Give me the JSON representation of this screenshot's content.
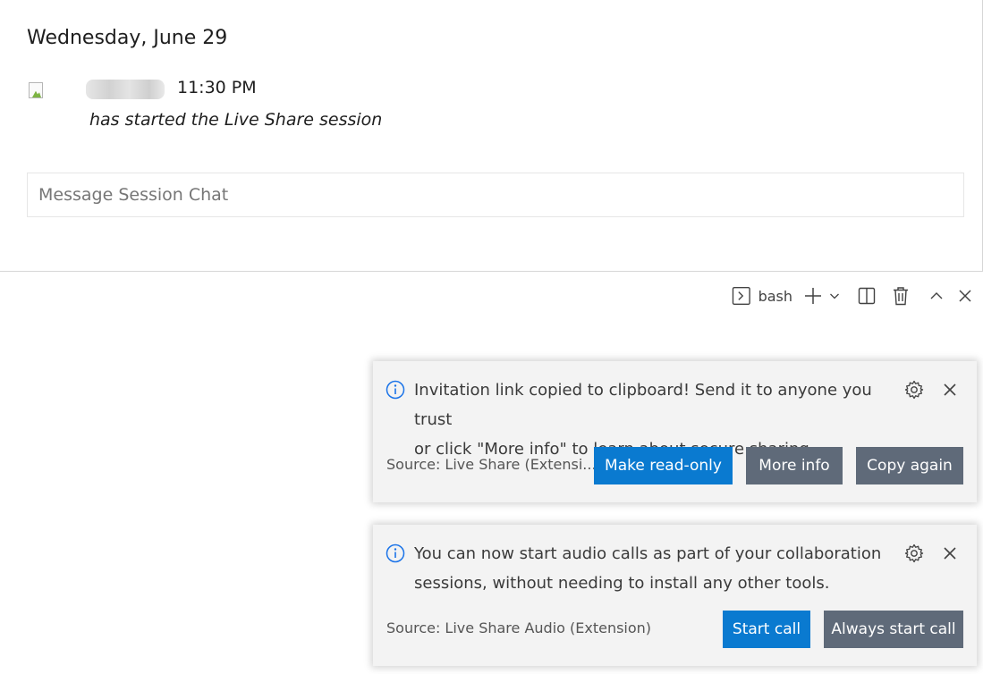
{
  "chat": {
    "date_heading": "Wednesday, June 29",
    "message": {
      "time": "11:30 PM",
      "text": "has started the Live Share session"
    },
    "input_placeholder": "Message Session Chat"
  },
  "terminal_toolbar": {
    "shell_label": "bash",
    "icons": [
      "terminal-icon",
      "plus-icon",
      "chevron-down-icon",
      "split-icon",
      "trash-icon",
      "chevron-up-icon",
      "close-icon"
    ]
  },
  "notifications": [
    {
      "message": "Invitation link copied to clipboard! Send it to anyone you trust or click \"More info\" to learn about secure sharing.",
      "message_line1": "Invitation link copied to clipboard! Send it to anyone you trust",
      "message_line2": "or click \"More info\" to learn about secure sharing.",
      "source": "Source: Live Share (Extensi...",
      "buttons": [
        "Make read-only",
        "More info",
        "Copy again"
      ]
    },
    {
      "message": "You can now start audio calls as part of your collaboration sessions, without needing to install any other tools.",
      "message_line1": "You can now start audio calls as part of your collaboration",
      "message_line2": "sessions, without needing to install any other tools.",
      "source": "Source: Live Share Audio (Extension)",
      "buttons": [
        "Start call",
        "Always start call"
      ]
    }
  ],
  "colors": {
    "primary_button": "#0a7ad0",
    "secondary_button": "#5f6a79",
    "info_icon": "#1a73e8",
    "toast_background": "#f3f3f3"
  }
}
